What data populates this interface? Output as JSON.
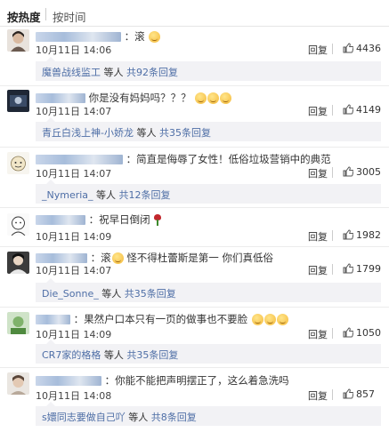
{
  "tabs": {
    "hot": "按热度",
    "time": "按时间"
  },
  "reply_label": "回复",
  "comments": [
    {
      "text": "：滚",
      "emoji_count": 1,
      "time": "10月11日 14:06",
      "likes": "4436",
      "sub_user": "魔兽战线监工",
      "sub_mid": " 等人 ",
      "sub_count": "共92条回复"
    },
    {
      "text": "你是没有妈妈吗？？？",
      "emoji_count": 3,
      "time": "10月11日 14:07",
      "likes": "4149",
      "sub_user": "青丘白浅上神-小娇龙",
      "sub_mid": " 等人 ",
      "sub_count": "共35条回复"
    },
    {
      "text": "：简直是侮辱了女性！低俗垃圾营销中的典范",
      "emoji_count": 0,
      "time": "10月11日 14:07",
      "likes": "3005",
      "sub_user": "_Nymeria_",
      "sub_mid": " 等人 ",
      "sub_count": "共12条回复"
    },
    {
      "text": "：祝早日倒闭",
      "emoji_count": 0,
      "rose": true,
      "time": "10月11日 14:09",
      "likes": "1982"
    },
    {
      "text": "：滚",
      "emoji_count": 1,
      "text2": "怪不得杜蕾斯是第一 你们真低俗",
      "time": "10月11日 14:07",
      "likes": "1799",
      "sub_user": "Die_Sonne_",
      "sub_mid": " 等人 ",
      "sub_count": "共35条回复"
    },
    {
      "text": "：果然户口本只有一页的做事也不要脸",
      "emoji_count": 3,
      "time": "10月11日 14:09",
      "likes": "1050",
      "sub_user": "CR7家的格格",
      "sub_mid": " 等人 ",
      "sub_count": "共35条回复"
    },
    {
      "text": "：你能不能把声明摆正了，这么着急洗吗",
      "emoji_count": 0,
      "time": "10月11日 14:08",
      "likes": "857",
      "sub_user": "s嬛同志要做自己吖",
      "sub_mid": " 等人 ",
      "sub_count": "共8条回复"
    }
  ],
  "colors": {
    "link": "#4e6ea6",
    "sub_bg": "#f2f2f5",
    "text": "#333333"
  }
}
